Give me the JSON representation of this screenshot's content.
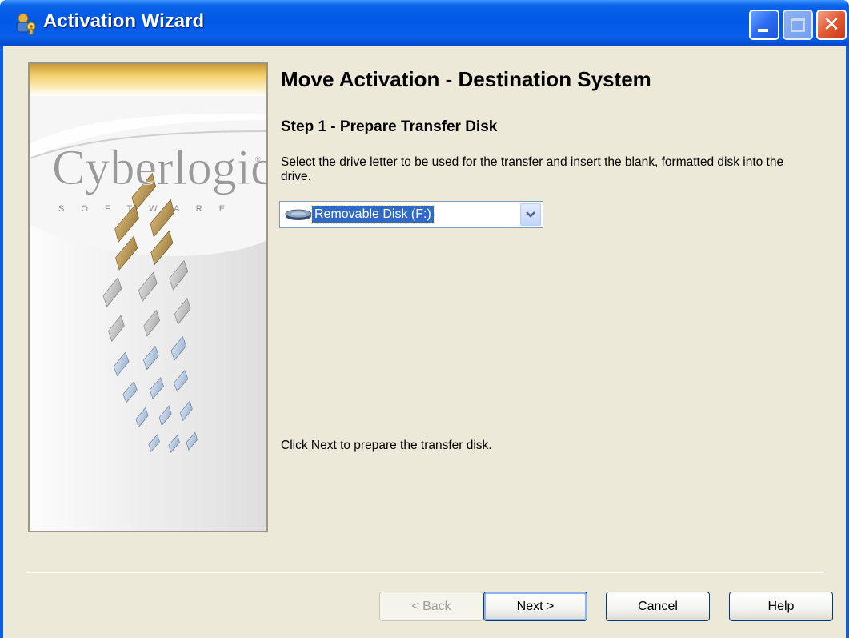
{
  "window": {
    "title": "Activation Wizard",
    "title_icon": "key-user-icon",
    "controls": {
      "minimize_icon": "minimize-icon",
      "maximize_icon": "maximize-icon",
      "close_glyph": "✕"
    }
  },
  "side_panel": {
    "logo_text": "Cyberlogic",
    "logo_trademark": "®",
    "logo_subtext": "S O F T W A R E"
  },
  "main": {
    "heading": "Move Activation - Destination System",
    "step_title": "Step 1 - Prepare Transfer Disk",
    "instructions": "Select the drive letter to be used for the transfer and insert the blank, formatted disk into the drive.",
    "drive_select": {
      "value": "Removable Disk (F:)",
      "icon": "removable-disk-icon"
    },
    "hint": "Click Next to prepare the transfer disk."
  },
  "buttons": {
    "back": "< Back",
    "next": "Next >",
    "cancel": "Cancel",
    "help": "Help"
  },
  "colors": {
    "titlebar": "#0058e6",
    "client_bg": "#ece9d8",
    "selection": "#316ac5",
    "accent_gold": "#b08a3e"
  }
}
